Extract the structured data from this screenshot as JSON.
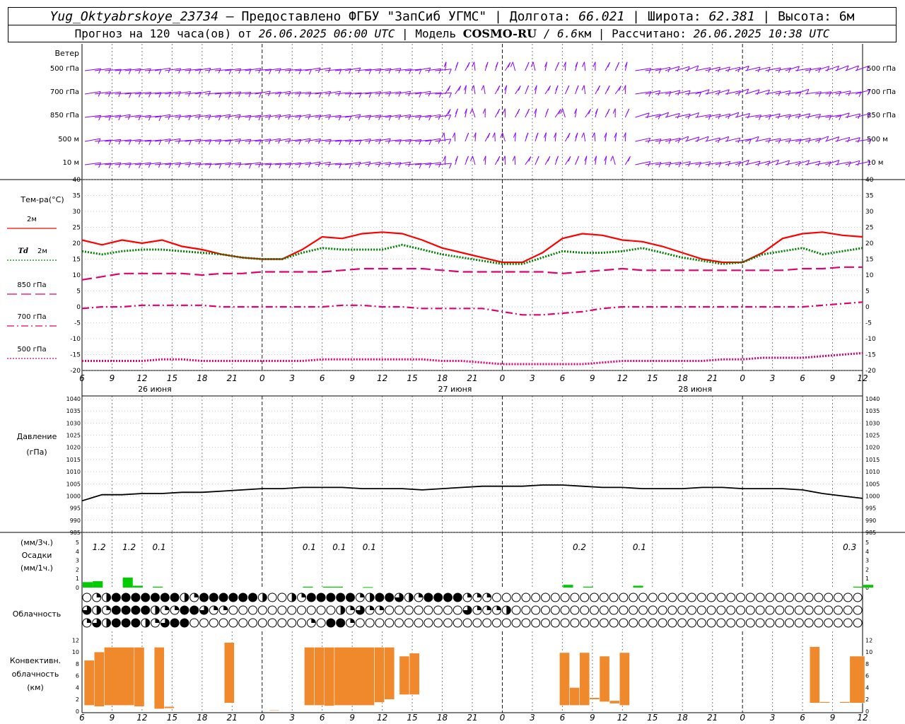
{
  "header": {
    "station": "Yug_Oktyabrskoye_23734",
    "provider": " – Предоставлено ФГБУ \"ЗапСиб УГМС\" | Долгота: ",
    "lon": "66.021",
    "lat_label": " | Широта: ",
    "lat": "62.381",
    "alt_label": " | Высота: 6м",
    "fc_label": "Прогноз на 120 часа(ов) от ",
    "fc_date": "26.06.2025 06:00 UTC",
    "model_label": " | Модель ",
    "model": "COSMO-RU",
    "res": " / 6.6",
    "res_unit": "км",
    "calc_label": " | Рассчитано: ",
    "calc_date": "26.06.2025 10:38 UTC"
  },
  "chart_data": {
    "time_ticks": [
      "6",
      "9",
      "12",
      "15",
      "18",
      "21",
      "0",
      "3",
      "6",
      "9",
      "12",
      "15",
      "18",
      "21",
      "0",
      "3",
      "6",
      "9",
      "12",
      "15",
      "18",
      "21",
      "0",
      "3",
      "6",
      "9",
      "12"
    ],
    "day_labels": [
      "26 июня",
      "27 июня",
      "28 июня"
    ],
    "wind": {
      "title": "Ветер",
      "levels": [
        "500 гПа",
        "700 гПа",
        "850 гПа",
        "500 м",
        "10 м"
      ],
      "barb_color": "#8b00ff"
    },
    "temperature": {
      "title": "Тем-ра(°С)",
      "type": "line",
      "ylim": [
        -20,
        40
      ],
      "yticks": [
        -20,
        -15,
        -10,
        -5,
        0,
        5,
        10,
        15,
        20,
        25,
        30,
        35,
        40
      ],
      "series": [
        {
          "name": "2м",
          "color": "#ff0000",
          "style": "solid",
          "values": [
            21,
            19.5,
            21,
            20,
            21,
            19,
            18,
            16.5,
            15.5,
            15,
            15,
            18,
            22,
            21.5,
            23,
            23.5,
            23,
            21,
            18.5,
            17,
            15.5,
            14,
            14,
            17,
            21.5,
            23,
            22.5,
            21,
            20.5,
            19,
            17,
            15,
            14,
            14,
            17,
            21.5,
            23,
            23.5,
            22.5,
            22
          ]
        },
        {
          "name": "Td 2м",
          "label_prefix": "Td",
          "label_suffix": "2м",
          "color": "#008000",
          "style": "dotted",
          "values": [
            17.5,
            16.5,
            17.5,
            18,
            18,
            17.5,
            17,
            16.5,
            15.5,
            15,
            15,
            17,
            18.5,
            18,
            18,
            18,
            19.5,
            18,
            16.5,
            15.5,
            14.5,
            13.5,
            13.5,
            15.5,
            17.5,
            17,
            17,
            17.5,
            18.5,
            17,
            15.5,
            14.5,
            13.5,
            14,
            16.5,
            17.5,
            18.5,
            16.5,
            17.5,
            18.5
          ]
        },
        {
          "name": "850 гПа",
          "color": "#e0006f",
          "style": "longdash",
          "values": [
            8.5,
            9.5,
            10.5,
            10.5,
            10.5,
            10.5,
            10,
            10.5,
            10.5,
            11,
            11,
            11,
            11,
            11.5,
            12,
            12,
            12,
            12,
            11.5,
            11,
            11,
            11,
            11,
            11,
            10.5,
            11,
            11.5,
            12,
            11.5,
            11.5,
            11.5,
            11.5,
            11.5,
            11.5,
            11.5,
            11.5,
            12,
            12,
            12.5,
            12.5
          ]
        },
        {
          "name": "700 гПа",
          "color": "#e0006f",
          "style": "dashdot",
          "values": [
            -0.5,
            0,
            0,
            0.5,
            0.5,
            0.5,
            0.5,
            0,
            0,
            0,
            0,
            0,
            0,
            0.5,
            0.5,
            0,
            0,
            -0.5,
            -0.5,
            -0.5,
            -0.5,
            -1.5,
            -2.5,
            -2.5,
            -2,
            -1.5,
            -0.5,
            0,
            0,
            0,
            0,
            0,
            0,
            0,
            0,
            0,
            0,
            0.5,
            1,
            1.5
          ]
        },
        {
          "name": "500 гПа",
          "color": "#e0006f",
          "style": "dotted",
          "values": [
            -17,
            -17,
            -17,
            -17,
            -16.5,
            -16.5,
            -17,
            -17,
            -17,
            -17,
            -17,
            -17,
            -16.5,
            -16.5,
            -16.5,
            -16.5,
            -16.5,
            -16.5,
            -17,
            -17,
            -17.5,
            -18,
            -18,
            -18,
            -18,
            -18,
            -17.5,
            -17,
            -17,
            -17,
            -17,
            -17,
            -16.5,
            -16.5,
            -16,
            -16,
            -16,
            -15.5,
            -15,
            -14.5
          ]
        }
      ]
    },
    "pressure": {
      "title": "Давление",
      "unit": "(гПа)",
      "type": "line",
      "ylim": [
        985,
        1040
      ],
      "yticks": [
        985,
        990,
        995,
        1000,
        1005,
        1010,
        1015,
        1020,
        1025,
        1030,
        1035,
        1040
      ],
      "values": [
        998,
        1000.5,
        1000.5,
        1001,
        1001,
        1001.5,
        1001.5,
        1002,
        1002.5,
        1003,
        1003,
        1003.5,
        1003.5,
        1003.5,
        1003,
        1003,
        1003,
        1002.5,
        1003,
        1003.5,
        1004,
        1004,
        1004,
        1004.5,
        1004.5,
        1004,
        1003.5,
        1003.5,
        1003,
        1003,
        1003,
        1003.5,
        1003.5,
        1003,
        1003,
        1003,
        1002.5,
        1001,
        1000,
        999
      ]
    },
    "precipitation": {
      "title": "Осадки",
      "unit_3h": "(мм/3ч.)",
      "unit_1h": "(мм/1ч.)",
      "type": "bar",
      "ylim": [
        0,
        5
      ],
      "yticks": [
        0,
        1,
        2,
        3,
        4,
        5
      ],
      "labels_3h": [
        {
          "hour_index": 1,
          "text": "1.2"
        },
        {
          "hour_index": 4,
          "text": "1.2"
        },
        {
          "hour_index": 7,
          "text": "0.1"
        },
        {
          "hour_index": 22,
          "text": "0.1"
        },
        {
          "hour_index": 25,
          "text": "0.1"
        },
        {
          "hour_index": 28,
          "text": "0.1"
        },
        {
          "hour_index": 49,
          "text": "0.2"
        },
        {
          "hour_index": 55,
          "text": "0.1"
        },
        {
          "hour_index": 76,
          "text": "0.3"
        }
      ],
      "hourly": [
        {
          "h": 0,
          "v": 0.6
        },
        {
          "h": 1,
          "v": 0.7
        },
        {
          "h": 4,
          "v": 1.1
        },
        {
          "h": 5,
          "v": 0.2
        },
        {
          "h": 7,
          "v": 0.1
        },
        {
          "h": 22,
          "v": 0.1
        },
        {
          "h": 24,
          "v": 0.1
        },
        {
          "h": 25,
          "v": 0.1
        },
        {
          "h": 28,
          "v": 0.05
        },
        {
          "h": 48,
          "v": 0.3
        },
        {
          "h": 50,
          "v": 0.1
        },
        {
          "h": 55,
          "v": 0.2
        },
        {
          "h": 77,
          "v": 0.1
        },
        {
          "h": 78,
          "v": 0.3
        }
      ],
      "color": "#00cc00"
    },
    "cloudiness": {
      "title": "Облачность",
      "rows": [
        "012444444421444444200214444412443214444111000000000000000000000000000000000000004440000000000000000000000000000000000000000000000001",
        "321444421144311000000000002131100000000311120000000000000000000000000000000000004310000000000000000000000000000000000000000000000004",
        "132444213440000000000001044100000000000000000000000000000000000000000000000000000002000000000000000000000000000000000000000000000014"
      ],
      "symbol_count": 80
    },
    "convective": {
      "title_lines": [
        "Конвективн.",
        "облачность",
        "(км)"
      ],
      "type": "range_bar",
      "ylim": [
        0,
        13
      ],
      "yticks": [
        0,
        2,
        4,
        6,
        8,
        10,
        12
      ],
      "bars": [
        {
          "h": 0.5,
          "w": 1,
          "base": 1,
          "top": 8.6
        },
        {
          "h": 1.5,
          "w": 1,
          "base": 0.8,
          "top": 10
        },
        {
          "h": 2.5,
          "w": 3,
          "base": 1,
          "top": 10.8
        },
        {
          "h": 5.5,
          "w": 1,
          "base": 0.8,
          "top": 10.8
        },
        {
          "h": 7.5,
          "w": 1,
          "base": 0.4,
          "top": 10.8
        },
        {
          "h": 8.5,
          "w": 1,
          "base": 0.5,
          "top": 0.8
        },
        {
          "h": 14.5,
          "w": 1,
          "base": 1.4,
          "top": 11.6
        },
        {
          "h": 19,
          "w": 1,
          "base": 0.1,
          "top": 0.2
        },
        {
          "h": 22.5,
          "w": 1,
          "base": 1,
          "top": 10.8
        },
        {
          "h": 23.5,
          "w": 1,
          "base": 1,
          "top": 10.8
        },
        {
          "h": 24.5,
          "w": 1,
          "base": 0.9,
          "top": 10.8
        },
        {
          "h": 25.5,
          "w": 4,
          "base": 1,
          "top": 10.8
        },
        {
          "h": 29.5,
          "w": 1,
          "base": 1.5,
          "top": 10.8
        },
        {
          "h": 30.5,
          "w": 1,
          "base": 2,
          "top": 10.8
        },
        {
          "h": 32,
          "w": 1,
          "base": 2.8,
          "top": 9.3
        },
        {
          "h": 33,
          "w": 1,
          "base": 2.8,
          "top": 9.8
        },
        {
          "h": 48,
          "w": 1,
          "base": 1,
          "top": 9.9
        },
        {
          "h": 49,
          "w": 1,
          "base": 1,
          "top": 4
        },
        {
          "h": 50,
          "w": 1,
          "base": 1,
          "top": 9.9
        },
        {
          "h": 51,
          "w": 1,
          "base": 2,
          "top": 2.3
        },
        {
          "h": 52,
          "w": 1,
          "base": 1.6,
          "top": 9.3
        },
        {
          "h": 53,
          "w": 1,
          "base": 1.3,
          "top": 1.8
        },
        {
          "h": 54,
          "w": 1,
          "base": 1,
          "top": 9.9
        },
        {
          "h": 73,
          "w": 1,
          "base": 1.4,
          "top": 10.9
        },
        {
          "h": 74,
          "w": 1,
          "base": 1.4,
          "top": 1.6
        },
        {
          "h": 76,
          "w": 1,
          "base": 1.4,
          "top": 1.6
        },
        {
          "h": 77,
          "w": 1.5,
          "base": 1.4,
          "top": 9.3
        }
      ],
      "color": "#f0882c"
    }
  }
}
